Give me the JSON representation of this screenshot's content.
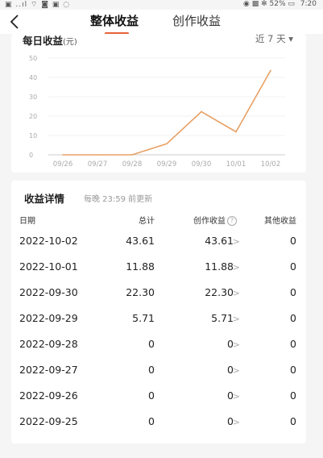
{
  "status_bar": {
    "left_icons": "▣ ..ıl ⌔ ◙ ▣ ◌",
    "right_icons": "◉ ▩ ✻ 52% ▭",
    "time": "7:20"
  },
  "nav": {
    "tabs": [
      {
        "label": "整体收益",
        "active": true
      },
      {
        "label": "创作收益",
        "active": false
      }
    ]
  },
  "chart_card": {
    "title": "每日收益",
    "unit": "(元)",
    "range_label": "近 7 天 ▾"
  },
  "chart_data": {
    "type": "line",
    "x": [
      "09/26",
      "09/27",
      "09/28",
      "09/29",
      "09/30",
      "10/01",
      "10/02"
    ],
    "y": [
      0,
      0,
      0,
      5.71,
      22.3,
      11.88,
      43.61
    ],
    "yticks": [
      0,
      10,
      20,
      30,
      40,
      50
    ],
    "ylim": [
      0,
      50
    ],
    "line_color": "#e8a064"
  },
  "detail": {
    "title": "收益详情",
    "note": "每晚 23:59 前更新",
    "columns": [
      "日期",
      "总计",
      "创作收益",
      "其他收益"
    ],
    "help_icon": "?",
    "rows": [
      {
        "date": "2022-10-02",
        "total": "43.61",
        "creation": "43.61",
        "other": "0"
      },
      {
        "date": "2022-10-01",
        "total": "11.88",
        "creation": "11.88",
        "other": "0"
      },
      {
        "date": "2022-09-30",
        "total": "22.30",
        "creation": "22.30",
        "other": "0"
      },
      {
        "date": "2022-09-29",
        "total": "5.71",
        "creation": "5.71",
        "other": "0"
      },
      {
        "date": "2022-09-28",
        "total": "0",
        "creation": "0",
        "other": "0"
      },
      {
        "date": "2022-09-27",
        "total": "0",
        "creation": "0",
        "other": "0"
      },
      {
        "date": "2022-09-26",
        "total": "0",
        "creation": "0",
        "other": "0"
      },
      {
        "date": "2022-09-25",
        "total": "0",
        "creation": "0",
        "other": "0"
      }
    ],
    "arrow": ">"
  },
  "colors": {
    "accent": "#e8623a",
    "line": "#e8a064",
    "background": "#f5f5f5"
  }
}
